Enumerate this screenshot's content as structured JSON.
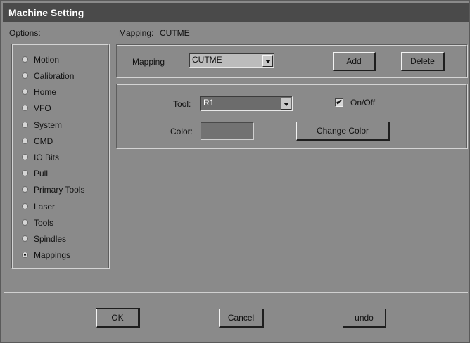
{
  "window": {
    "title": "Machine Setting"
  },
  "options": {
    "label": "Options:",
    "selected": "Mappings",
    "items": [
      {
        "label": "Motion",
        "selected": false
      },
      {
        "label": "Calibration",
        "selected": false
      },
      {
        "label": "Home",
        "selected": false
      },
      {
        "label": "VFO",
        "selected": false
      },
      {
        "label": "System",
        "selected": false
      },
      {
        "label": "CMD",
        "selected": false
      },
      {
        "label": "IO Bits",
        "selected": false
      },
      {
        "label": "Pull",
        "selected": false
      },
      {
        "label": "Primary Tools",
        "selected": false
      },
      {
        "label": "Laser",
        "selected": false
      },
      {
        "label": "Tools",
        "selected": false
      },
      {
        "label": "Spindles",
        "selected": false
      },
      {
        "label": "Mappings",
        "selected": true
      }
    ]
  },
  "header": {
    "mapping_label": "Mapping:",
    "mapping_value": "CUTME"
  },
  "mapping_panel": {
    "label": "Mapping",
    "selected": "CUTME",
    "add_label": "Add",
    "delete_label": "Delete"
  },
  "tool_panel": {
    "tool_label": "Tool:",
    "tool_value": "R1",
    "onoff_label": "On/Off",
    "onoff_checked": true,
    "check_mark": "✔",
    "color_label": "Color:",
    "color_value": "#727272",
    "change_color_label": "Change Color"
  },
  "footer": {
    "ok_label": "OK",
    "cancel_label": "Cancel",
    "undo_label": "undo"
  }
}
